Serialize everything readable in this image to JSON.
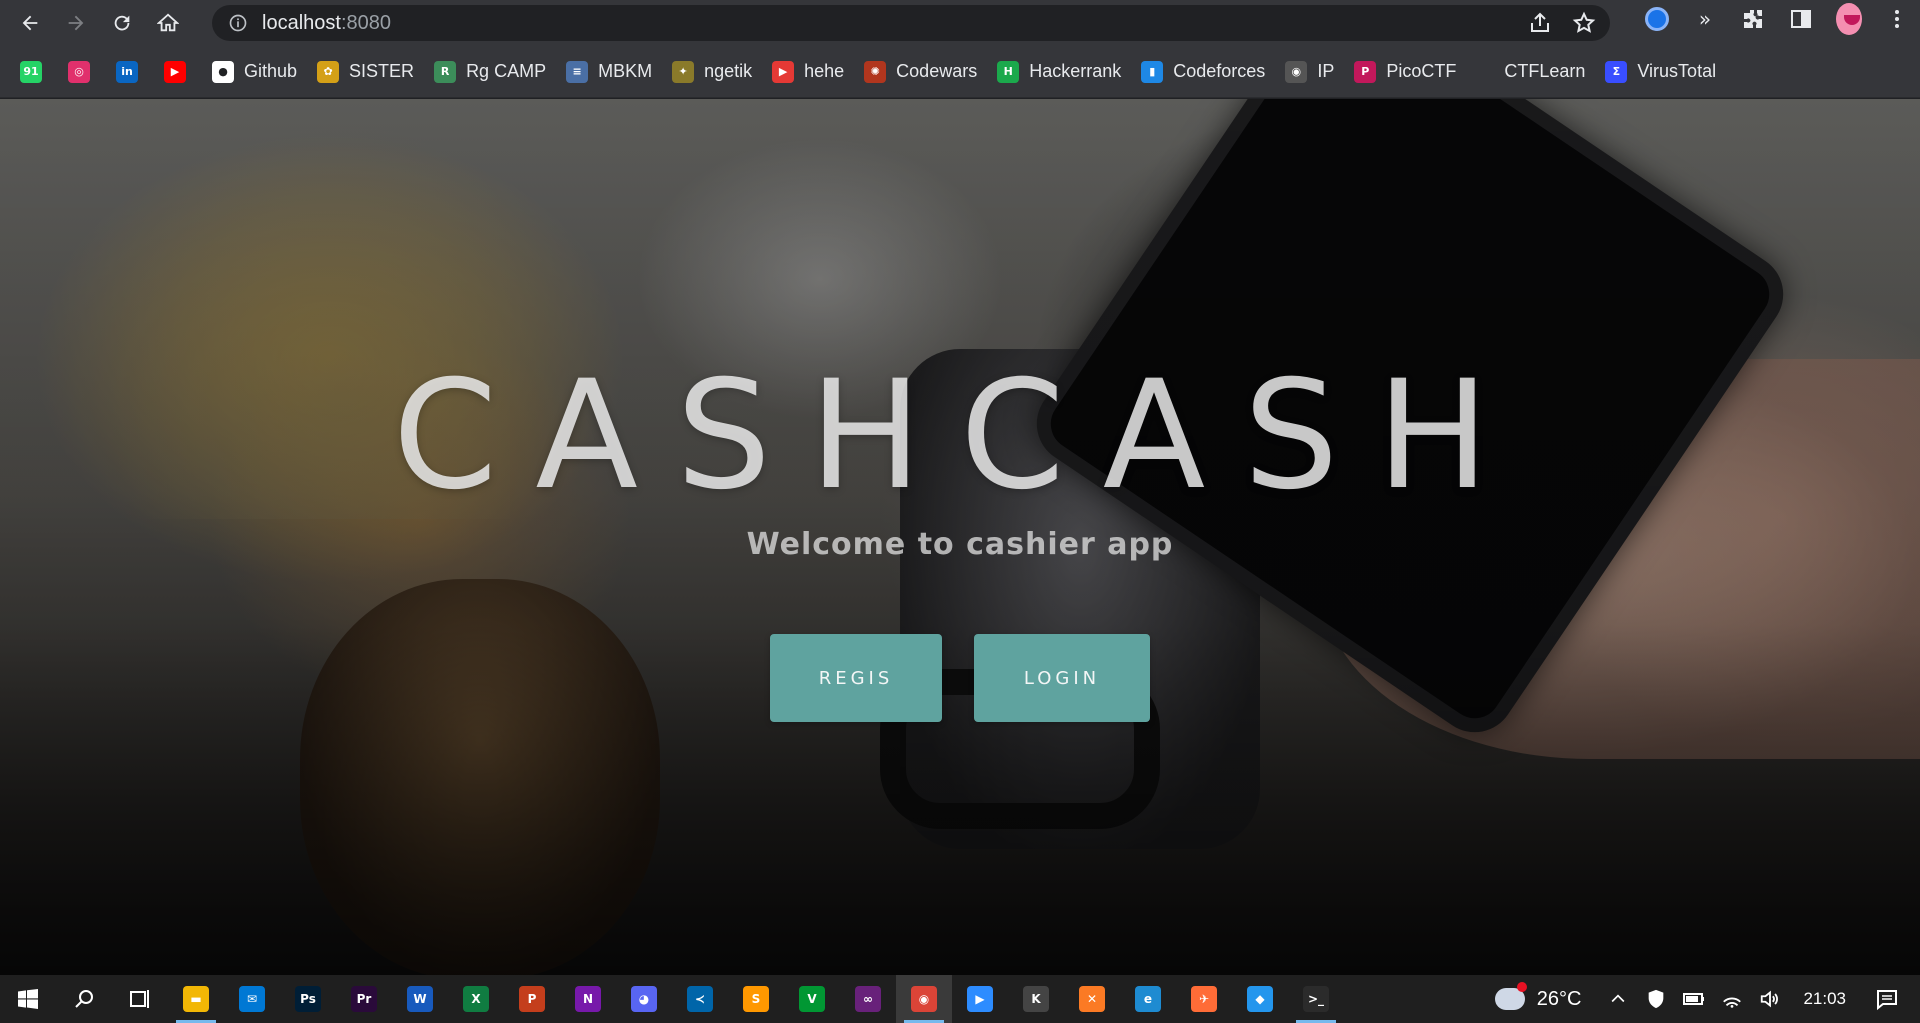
{
  "browser": {
    "url_host": "localhost",
    "url_port": ":8080",
    "icons": {
      "back": "back-arrow-icon",
      "forward": "forward-arrow-icon",
      "reload": "reload-icon",
      "home": "home-icon",
      "site_info": "info-icon",
      "share": "share-icon",
      "bookmark": "star-icon",
      "extensions": "puzzle-icon",
      "side_panel": "side-panel-icon",
      "menu": "kebab-menu-icon"
    }
  },
  "bookmarks": [
    {
      "label": "",
      "icon": "whatsapp-icon",
      "color": "#25d366",
      "glyph": "91"
    },
    {
      "label": "",
      "icon": "instagram-icon",
      "color": "#e1306c",
      "glyph": "◎"
    },
    {
      "label": "",
      "icon": "linkedin-icon",
      "color": "#0a66c2",
      "glyph": "in"
    },
    {
      "label": "",
      "icon": "youtube-icon",
      "color": "#ff0000",
      "glyph": "▶"
    },
    {
      "label": "Github",
      "icon": "github-icon",
      "color": "#ffffff",
      "glyph": "●"
    },
    {
      "label": "SISTER",
      "icon": "sister-icon",
      "color": "#d4a017",
      "glyph": "✿"
    },
    {
      "label": "Rg CAMP",
      "icon": "rgcamp-icon",
      "color": "#3c8d5a",
      "glyph": "R"
    },
    {
      "label": "MBKM",
      "icon": "mbkm-icon",
      "color": "#4a6fa5",
      "glyph": "≡"
    },
    {
      "label": "ngetik",
      "icon": "ngetik-icon",
      "color": "#8a7a2a",
      "glyph": "✦"
    },
    {
      "label": "hehe",
      "icon": "hehe-icon",
      "color": "#e53935",
      "glyph": "▶"
    },
    {
      "label": "Codewars",
      "icon": "codewars-icon",
      "color": "#b1361e",
      "glyph": "✺"
    },
    {
      "label": "Hackerrank",
      "icon": "hackerrank-icon",
      "color": "#1ba94c",
      "glyph": "H"
    },
    {
      "label": "Codeforces",
      "icon": "codeforces-icon",
      "color": "#1e88e5",
      "glyph": "▮"
    },
    {
      "label": "IP",
      "icon": "globe-icon",
      "color": "#555555",
      "glyph": "◉"
    },
    {
      "label": "PicoCTF",
      "icon": "picoctf-icon",
      "color": "#c2185b",
      "glyph": "P"
    },
    {
      "label": "CTFLearn",
      "icon": "ctflearn-icon",
      "color": "#35363a",
      "glyph": ""
    },
    {
      "label": "VirusTotal",
      "icon": "virustotal-icon",
      "color": "#394eff",
      "glyph": "Σ"
    }
  ],
  "hero": {
    "title": "CASHCASH",
    "subtitle": "Welcome to cashier app",
    "regis_label": "REGIS",
    "login_label": "LOGIN",
    "button_color": "#5fa39f"
  },
  "taskbar": {
    "apps": [
      {
        "icon": "file-explorer-icon",
        "color": "#f2b705",
        "glyph": "▬",
        "open": true
      },
      {
        "icon": "mail-icon",
        "color": "#0078d4",
        "glyph": "✉",
        "open": false
      },
      {
        "icon": "photoshop-icon",
        "color": "#001e36",
        "glyph": "Ps",
        "open": false
      },
      {
        "icon": "premiere-icon",
        "color": "#2a0a3a",
        "glyph": "Pr",
        "open": false
      },
      {
        "icon": "word-icon",
        "color": "#185abd",
        "glyph": "W",
        "open": false
      },
      {
        "icon": "excel-icon",
        "color": "#107c41",
        "glyph": "X",
        "open": false
      },
      {
        "icon": "powerpoint-icon",
        "color": "#c43e1c",
        "glyph": "P",
        "open": false
      },
      {
        "icon": "onenote-icon",
        "color": "#7719aa",
        "glyph": "N",
        "open": false
      },
      {
        "icon": "discord-icon",
        "color": "#5865f2",
        "glyph": "◕",
        "open": false
      },
      {
        "icon": "vscode-icon",
        "color": "#0065a9",
        "glyph": "≺",
        "open": false
      },
      {
        "icon": "sublime-icon",
        "color": "#ff9800",
        "glyph": "S",
        "open": false
      },
      {
        "icon": "vim-icon",
        "color": "#019733",
        "glyph": "V",
        "open": false
      },
      {
        "icon": "visual-studio-icon",
        "color": "#68217a",
        "glyph": "∞",
        "open": false
      },
      {
        "icon": "chrome-icon",
        "color": "#db4437",
        "glyph": "◉",
        "open": true,
        "active": true
      },
      {
        "icon": "zoom-icon",
        "color": "#2d8cff",
        "glyph": "▶",
        "open": false
      },
      {
        "icon": "kali-icon",
        "color": "#444444",
        "glyph": "K",
        "open": false
      },
      {
        "icon": "xampp-icon",
        "color": "#fb7a24",
        "glyph": "✕",
        "open": false
      },
      {
        "icon": "edge-icon",
        "color": "#1e8bd1",
        "glyph": "e",
        "open": false
      },
      {
        "icon": "postman-icon",
        "color": "#ff6c37",
        "glyph": "✈",
        "open": false
      },
      {
        "icon": "docker-icon",
        "color": "#2496ed",
        "glyph": "◆",
        "open": false
      },
      {
        "icon": "terminal-icon",
        "color": "#2b2b2b",
        "glyph": ">_",
        "open": true
      }
    ],
    "temperature": "26°C",
    "time": "21:03"
  }
}
